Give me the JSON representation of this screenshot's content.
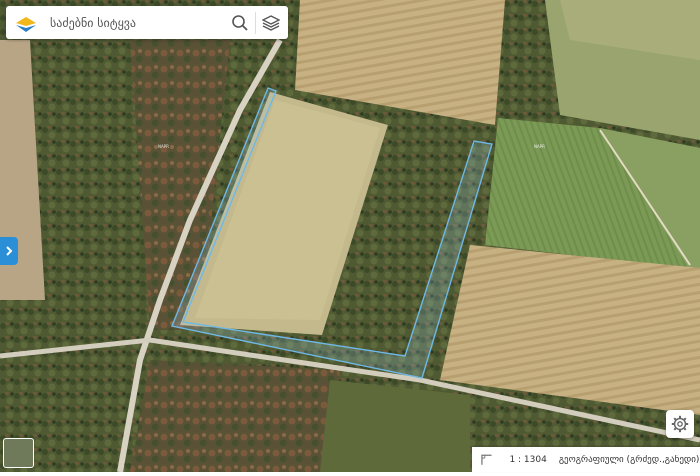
{
  "search": {
    "placeholder": "საძებნი სიტყვა"
  },
  "icons": {
    "logo": "napr-logo",
    "search": "search-icon",
    "layers": "layers-icon",
    "side_toggle": "chevron-right-icon",
    "settings": "gear-icon",
    "scale": "ruler-icon"
  },
  "map": {
    "parcel_labels": [
      "NAPR",
      "NAPR"
    ],
    "highlight_color": "#6fb8e6"
  },
  "status": {
    "scale": "1 : 1304",
    "crs": "გეოგრაფიული (გრძედ.,განედი)"
  },
  "colors": {
    "accent": "#2a8fd6"
  }
}
